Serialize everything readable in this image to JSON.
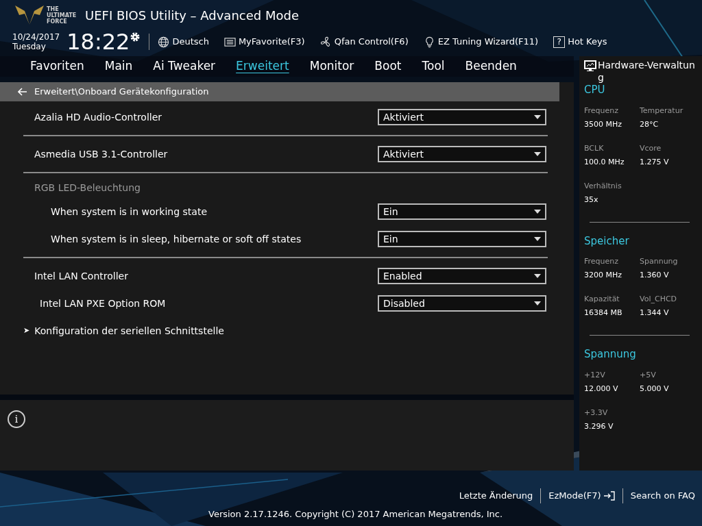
{
  "header": {
    "logo_text": "THE ULTIMATE FORCE",
    "title": "UEFI BIOS Utility – Advanced Mode",
    "date": "10/24/2017",
    "day": "Tuesday",
    "time": "18:22",
    "tools": [
      {
        "kind": "globe",
        "label": "Deutsch"
      },
      {
        "kind": "list",
        "label": "MyFavorite(F3)"
      },
      {
        "kind": "fan",
        "label": "Qfan Control(F6)"
      },
      {
        "kind": "bulb",
        "label": "EZ Tuning Wizard(F11)"
      },
      {
        "kind": "help",
        "label": "Hot Keys",
        "glyph": "?"
      }
    ]
  },
  "tabs": [
    {
      "label": "Favoriten",
      "selected": false
    },
    {
      "label": "Main",
      "selected": false
    },
    {
      "label": "Ai Tweaker",
      "selected": false
    },
    {
      "label": "Erweitert",
      "selected": true
    },
    {
      "label": "Monitor",
      "selected": false
    },
    {
      "label": "Boot",
      "selected": false
    },
    {
      "label": "Tool",
      "selected": false
    },
    {
      "label": "Beenden",
      "selected": false
    }
  ],
  "breadcrumb": "Erweitert\\Onboard Gerätekonfiguration",
  "items": [
    {
      "kind": "setting",
      "label": "Azalia HD Audio-Controller",
      "value": "Aktiviert"
    },
    {
      "kind": "divider"
    },
    {
      "kind": "setting",
      "label": "Asmedia USB 3.1-Controller",
      "value": "Aktiviert"
    },
    {
      "kind": "divider"
    },
    {
      "kind": "group",
      "label": "RGB LED-Beleuchtung",
      "children": [
        {
          "kind": "setting",
          "label": "When system is in working state",
          "value": "Ein"
        },
        {
          "kind": "setting",
          "label": "When system is in sleep, hibernate or soft off states",
          "value": "Ein"
        }
      ]
    },
    {
      "kind": "divider"
    },
    {
      "kind": "setting",
      "label": "Intel LAN Controller",
      "value": "Enabled"
    },
    {
      "kind": "subsetting",
      "label": "Intel LAN PXE Option ROM",
      "value": "Disabled"
    },
    {
      "kind": "submenu",
      "glyph": "➤",
      "label": "Konfiguration der seriellen Schnittstelle"
    }
  ],
  "info_glyph": "i",
  "hardware": {
    "title": "Hardware-Verwaltung",
    "sections": [
      {
        "title": "CPU",
        "cells": [
          {
            "label": "Frequenz",
            "value": "3500 MHz"
          },
          {
            "label": "Temperatur",
            "value": "28°C"
          },
          {
            "label": "BCLK",
            "value": "100.0 MHz"
          },
          {
            "label": "Vcore",
            "value": "1.275 V"
          },
          {
            "label": "Verhältnis",
            "value": "35x"
          }
        ]
      },
      {
        "title": "Speicher",
        "cells": [
          {
            "label": "Frequenz",
            "value": "3200 MHz"
          },
          {
            "label": "Spannung",
            "value": "1.360 V"
          },
          {
            "label": "Kapazität",
            "value": "16384 MB"
          },
          {
            "label": "Vol_CHCD",
            "value": "1.344 V"
          }
        ]
      },
      {
        "title": "Spannung",
        "cells": [
          {
            "label": "+12V",
            "value": "12.000 V"
          },
          {
            "label": "+5V",
            "value": "5.000 V"
          },
          {
            "label": "+3.3V",
            "value": "3.296 V"
          }
        ]
      }
    ]
  },
  "footer": {
    "links": [
      {
        "label": "Letzte Änderung"
      },
      {
        "label": "EzMode(F7)",
        "icon": true
      },
      {
        "label": "Search on FAQ"
      }
    ],
    "version": "Version 2.17.1246. Copyright (C) 2017 American Megatrends, Inc."
  }
}
